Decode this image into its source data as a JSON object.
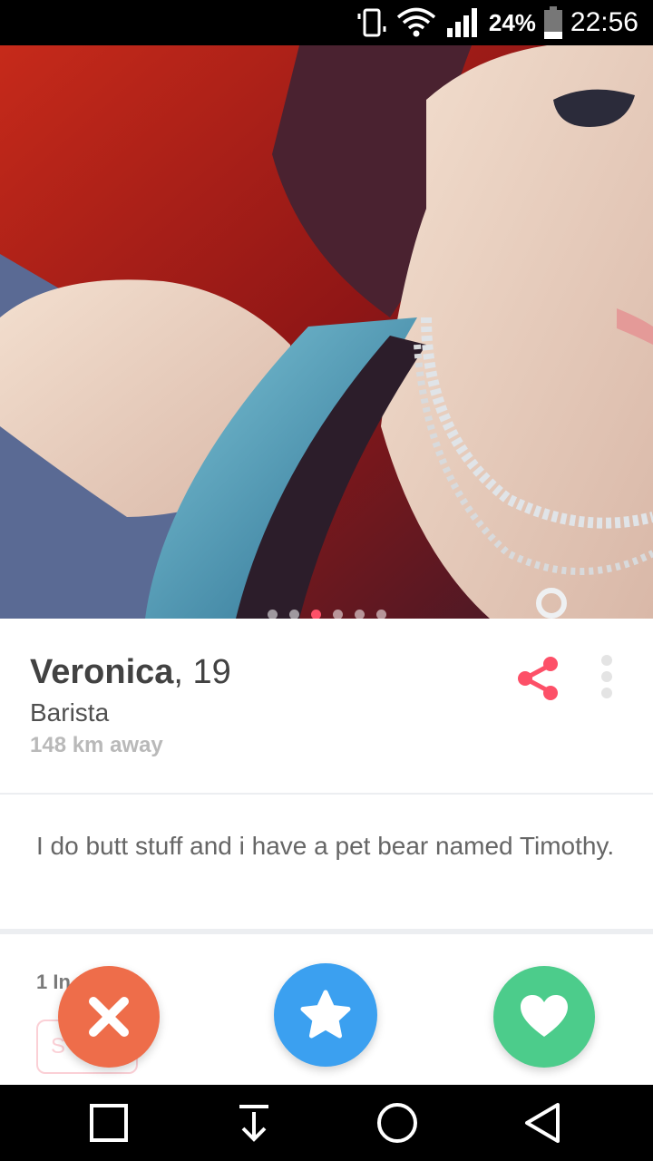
{
  "status_bar": {
    "battery_percent": "24%",
    "time": "22:56",
    "icons": [
      "vibrate-icon",
      "wifi-icon",
      "signal-icon",
      "battery-icon"
    ]
  },
  "photo": {
    "dot_count": 6,
    "active_dot_index": 2
  },
  "profile": {
    "name": "Veronica",
    "age": "19",
    "job": "Barista",
    "distance": "148 km away"
  },
  "bio": {
    "text": "I do butt stuff and i have a pet bear named Timothy."
  },
  "lower": {
    "interests_label": "1 In",
    "pill_label": "S"
  },
  "actions": {
    "nope_icon": "close-icon",
    "superlike_icon": "star-icon",
    "like_icon": "heart-icon"
  },
  "colors": {
    "accent": "#fd5068",
    "nope": "#ee6d4a",
    "superlike": "#3ba0f0",
    "like": "#4ccc8b"
  },
  "nav": {
    "icons": [
      "recents-square-icon",
      "download-icon",
      "home-circle-icon",
      "back-triangle-icon"
    ]
  }
}
